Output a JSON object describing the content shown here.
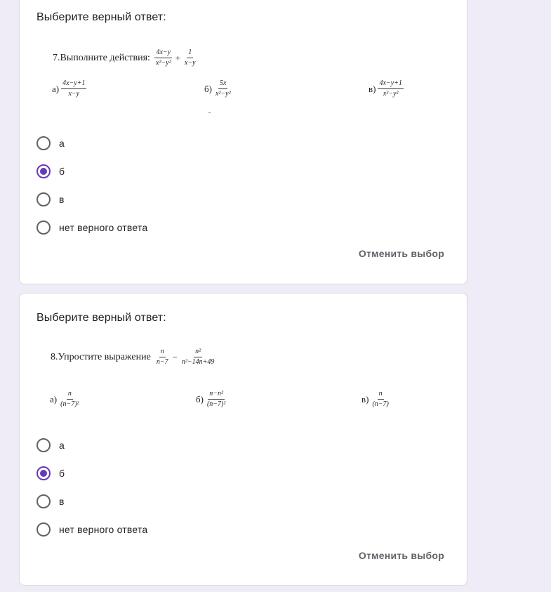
{
  "accent_color": "#673ab7",
  "page_background": "#efebf7",
  "questions": [
    {
      "prompt": "Выберите верный ответ:",
      "task_title": "7.Выполните действия:",
      "expression": {
        "frac1": {
          "num": "4x−y",
          "den": "x²−y²"
        },
        "operator": "+",
        "frac2": {
          "num": "1",
          "den": "x−y"
        }
      },
      "answers": [
        {
          "letter": "а)",
          "num": "4x−y+1",
          "den": "x−y"
        },
        {
          "letter": "б)",
          "num": "5x",
          "den": "x²−y²"
        },
        {
          "letter": "в)",
          "num": "4x−y+1",
          "den": "x²−y²"
        }
      ],
      "choices": [
        {
          "label": "а",
          "checked": false
        },
        {
          "label": "б",
          "checked": true
        },
        {
          "label": "в",
          "checked": false
        },
        {
          "label": "нет верного ответа",
          "checked": false
        }
      ],
      "clear_label": "Отменить выбор"
    },
    {
      "prompt": "Выберите верный ответ:",
      "task_title": "8.Упростите выражение",
      "expression": {
        "frac1": {
          "num": "n",
          "den": "n−7"
        },
        "operator": "−",
        "frac2": {
          "num": "n²",
          "den": "n²−14n+49"
        }
      },
      "answers": [
        {
          "letter": "а)",
          "num": "n",
          "den": "(n−7)²"
        },
        {
          "letter": "б)",
          "num": "n−n²",
          "den": "(n−7)²"
        },
        {
          "letter": "в)",
          "num": "n",
          "den": "(n−7)"
        }
      ],
      "choices": [
        {
          "label": "а",
          "checked": false
        },
        {
          "label": "б",
          "checked": true
        },
        {
          "label": "в",
          "checked": false
        },
        {
          "label": "нет верного ответа",
          "checked": false
        }
      ],
      "clear_label": "Отменить выбор"
    }
  ]
}
